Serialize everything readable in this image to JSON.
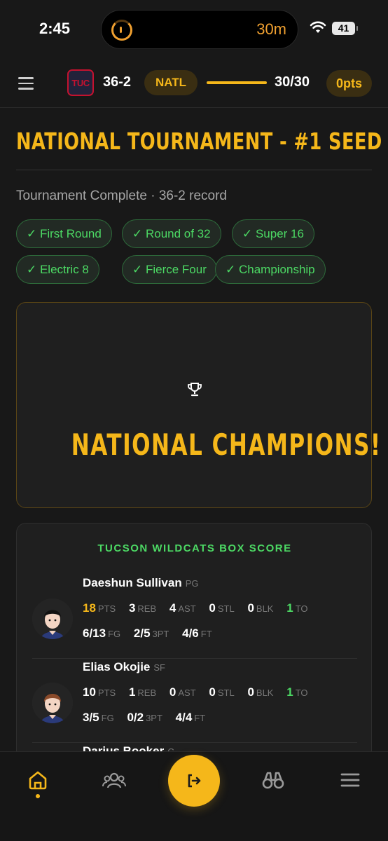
{
  "status_bar": {
    "time": "2:45",
    "timer": "30m",
    "battery": "41"
  },
  "header": {
    "team_abbr": "TUC",
    "record": "36-2",
    "stage": "NATL",
    "games_progress": 1.0,
    "games": "30/30",
    "points": "0pts"
  },
  "page": {
    "title": "NATIONAL TOURNAMENT - #1 SEED",
    "subtitle": "Tournament Complete · 36-2 record"
  },
  "rounds": [
    "✓ First Round",
    "✓ Round of 32",
    "✓ Super 16",
    "✓ Electric 8",
    "✓ Fierce Four",
    "✓ Championship"
  ],
  "champion": {
    "title": "NATIONAL CHAMPIONS!",
    "icon": "trophy-icon"
  },
  "box_score": {
    "title": "TUCSON WILDCATS BOX SCORE",
    "labels": {
      "pts": "PTS",
      "reb": "REB",
      "ast": "AST",
      "stl": "STL",
      "blk": "BLK",
      "to": "TO",
      "fg": "FG",
      "tpt": "3PT",
      "ft": "FT"
    },
    "players": [
      {
        "name": "Daeshun Sullivan",
        "pos": "PG",
        "pts": "18",
        "reb": "3",
        "ast": "4",
        "stl": "0",
        "blk": "0",
        "to": "1",
        "fg": "6/13",
        "tpt": "2/5",
        "ft": "4/6"
      },
      {
        "name": "Elias Okojie",
        "pos": "SF",
        "pts": "10",
        "reb": "1",
        "ast": "0",
        "stl": "0",
        "blk": "0",
        "to": "1",
        "fg": "3/5",
        "tpt": "0/2",
        "ft": "4/4"
      },
      {
        "name": "Darius Booker",
        "pos": "C"
      }
    ]
  },
  "bottom_nav": [
    {
      "icon": "home-icon",
      "active": true
    },
    {
      "icon": "team-icon",
      "active": false
    },
    {
      "icon": "exit-icon",
      "active": false
    },
    {
      "icon": "binoculars-icon",
      "active": false
    },
    {
      "icon": "menu-icon",
      "active": false
    }
  ],
  "colors": {
    "accent": "#f5b71a",
    "success": "#4cd964",
    "background": "#181818",
    "card": "#1f1f1f"
  }
}
